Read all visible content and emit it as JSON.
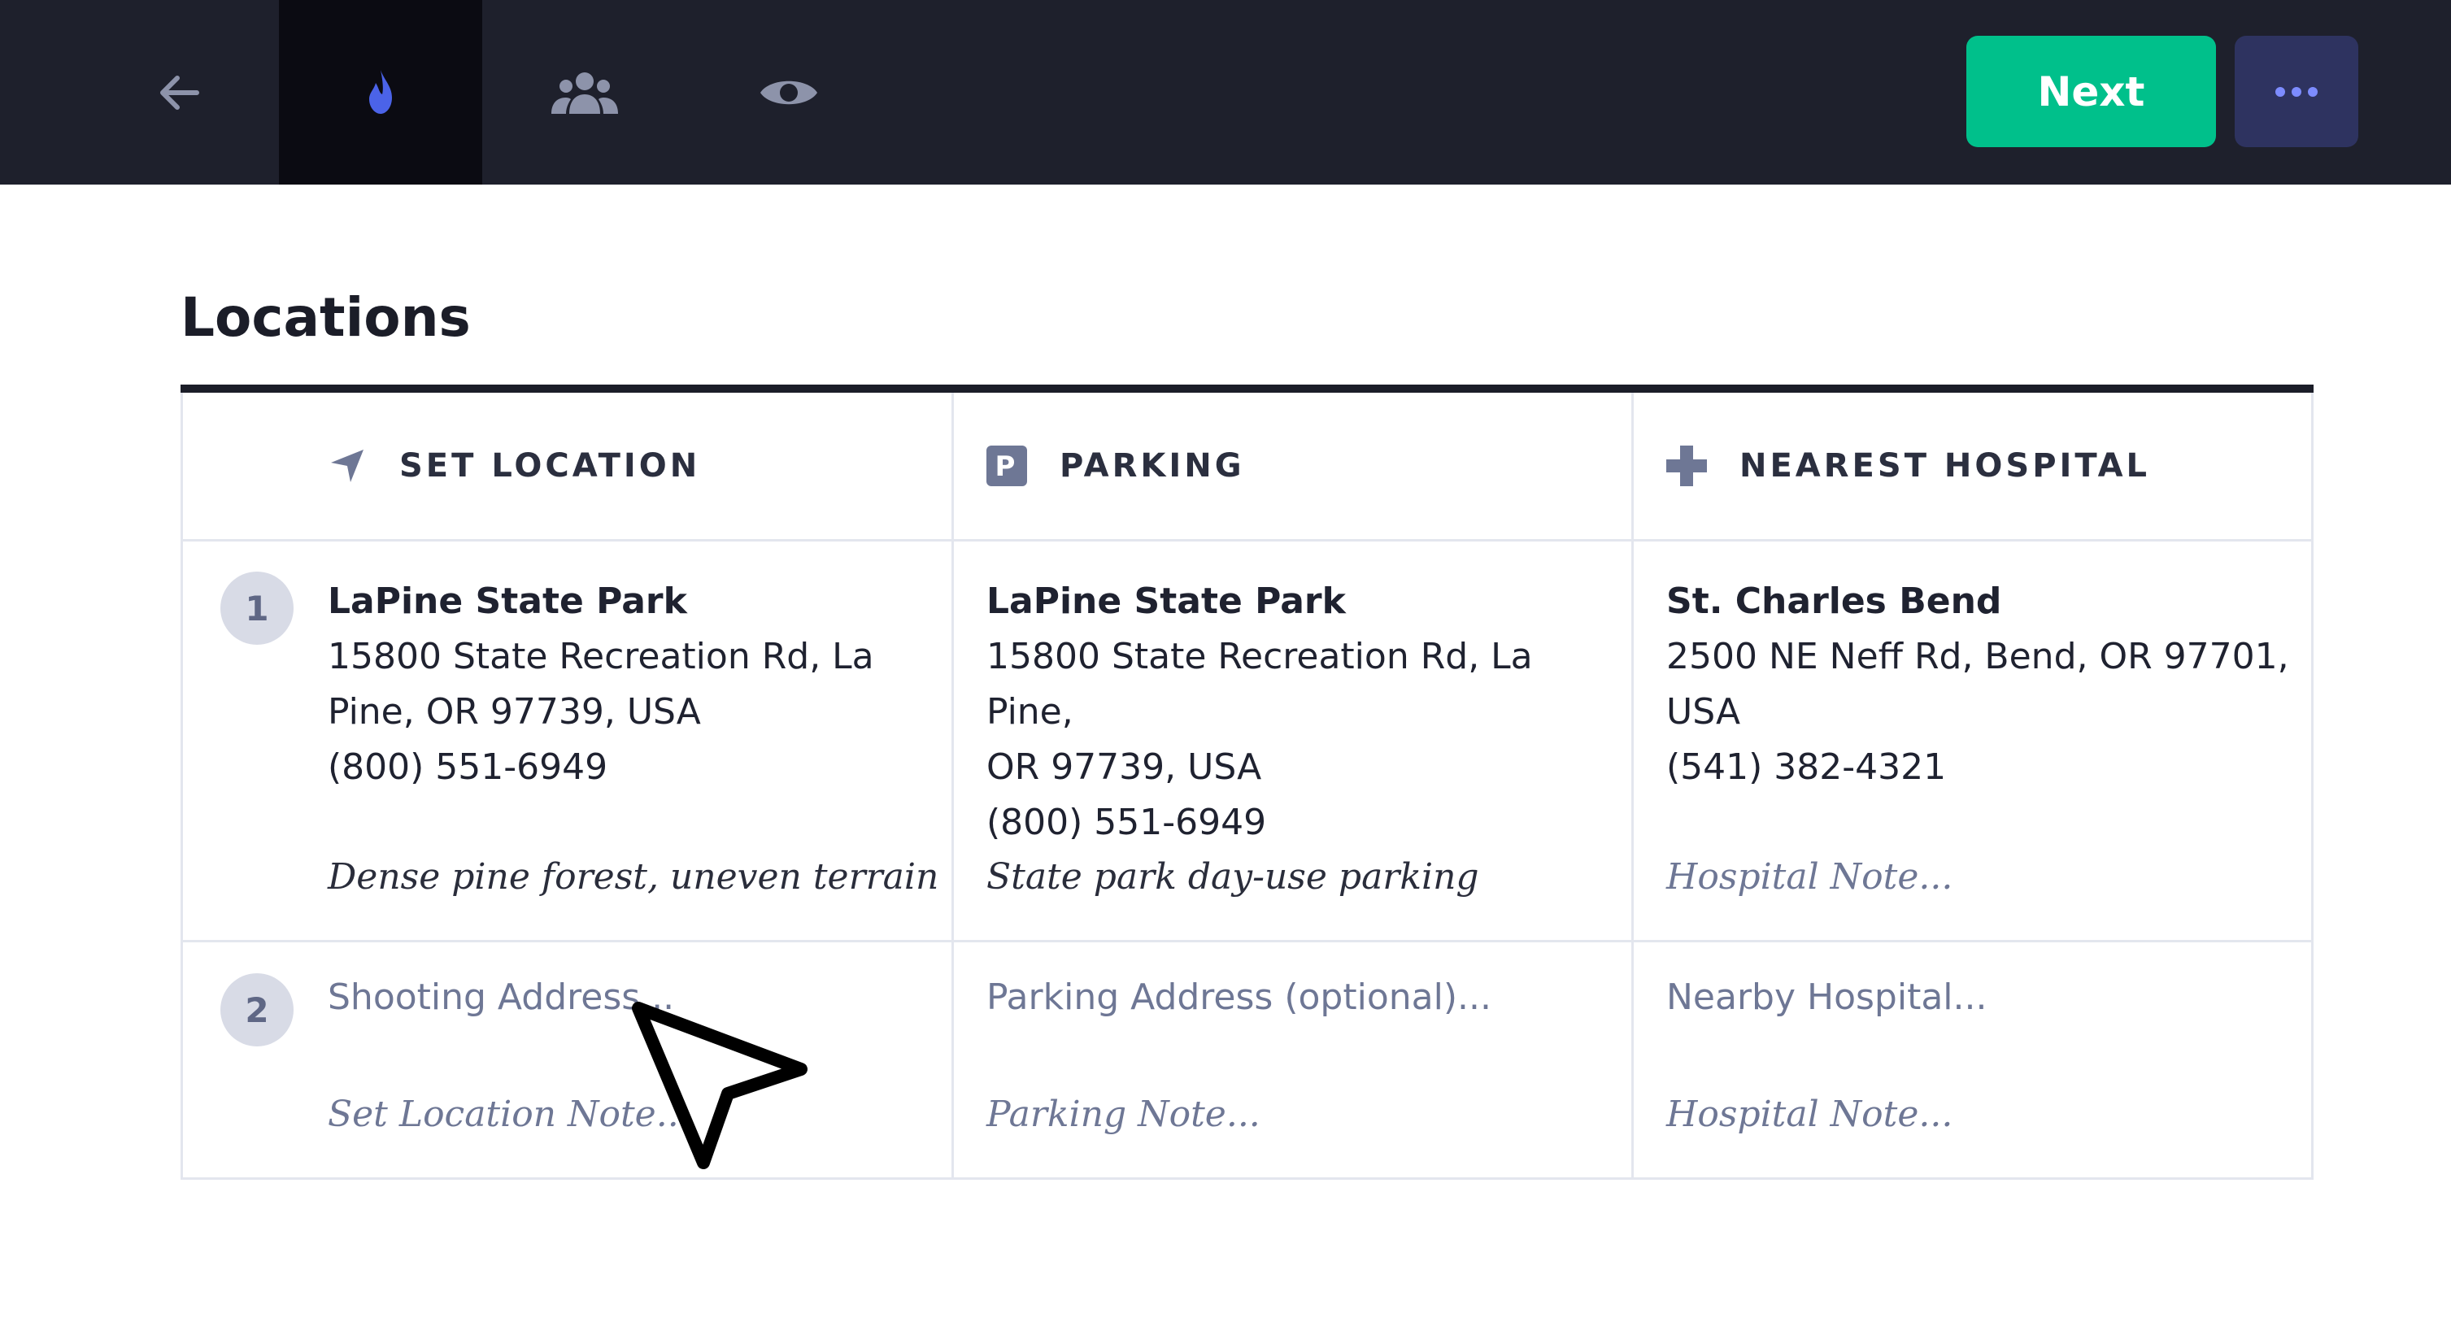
{
  "toolbar": {
    "next_label": "Next"
  },
  "icons": {
    "back": "arrow-left-icon",
    "flame": "flame-icon",
    "team": "people-icon",
    "preview": "eye-icon",
    "more": "ellipsis-icon"
  },
  "colors": {
    "topbar": "#1e202c",
    "next": "#00c08b",
    "more": "#2e3360",
    "accent": "#4b63e8"
  },
  "page": {
    "title": "Locations"
  },
  "columns": [
    {
      "label": "SET LOCATION",
      "icon": "navigation-arrow-icon"
    },
    {
      "label": "PARKING",
      "icon": "parking-icon"
    },
    {
      "label": "NEAREST HOSPITAL",
      "icon": "medical-cross-icon"
    }
  ],
  "rows": [
    {
      "number": "1",
      "set_location": {
        "name": "LaPine State Park",
        "address_line1": "15800 State Recreation Rd, La",
        "address_line2": "Pine, OR 97739, USA",
        "phone": "(800) 551-6949",
        "note": "Dense pine forest, uneven terrain"
      },
      "parking": {
        "name": "LaPine State Park",
        "address_line1": "15800 State Recreation Rd, La Pine,",
        "address_line2": "OR 97739, USA",
        "phone": "(800) 551-6949",
        "note": "State park day-use parking"
      },
      "hospital": {
        "name": "St. Charles Bend",
        "address_line1": "2500 NE Neff Rd, Bend, OR 97701,",
        "address_line2": "USA",
        "phone": "(541) 382-4321",
        "note_placeholder": "Hospital Note..."
      }
    },
    {
      "number": "2",
      "set_location": {
        "address_placeholder": "Shooting Address...",
        "note_placeholder": "Set Location Note..."
      },
      "parking": {
        "address_placeholder": "Parking Address (optional)...",
        "note_placeholder": "Parking Note..."
      },
      "hospital": {
        "address_placeholder": "Nearby Hospital...",
        "note_placeholder": "Hospital Note..."
      }
    }
  ]
}
